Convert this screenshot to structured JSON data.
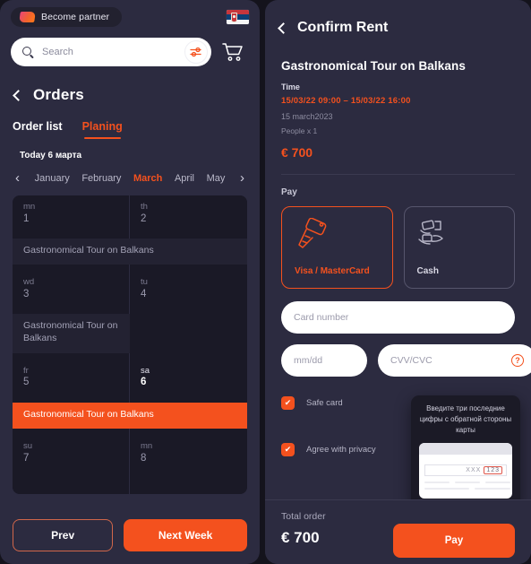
{
  "left": {
    "partner_badge": {
      "label": "Become partner",
      "icon": "partner-logo-icon"
    },
    "flag": "serbia-flag-icon",
    "search": {
      "value": "",
      "placeholder": "Search",
      "icon": "search-icon",
      "filter_icon": "filter-sliders-icon"
    },
    "cart_icon": "shopping-cart-icon",
    "back_icon": "chevron-left-icon",
    "page_title": "Orders",
    "tabs": [
      {
        "label": "Order list",
        "active": false
      },
      {
        "label": "Planing",
        "active": true
      }
    ],
    "today_label": "Today 6 марта",
    "month_prev_icon": "chevron-left-icon",
    "month_next_icon": "chevron-right-icon",
    "months": [
      {
        "label": "January",
        "active": false
      },
      {
        "label": "February",
        "active": false
      },
      {
        "label": "March",
        "active": true
      },
      {
        "label": "April",
        "active": false
      },
      {
        "label": "May",
        "active": false
      }
    ],
    "calendar": {
      "rows": [
        {
          "cells": [
            {
              "dow": "mn",
              "num": "1",
              "today": false
            },
            {
              "dow": "th",
              "num": "2",
              "today": false
            }
          ],
          "event": {
            "text": "Gastronomical Tour on Balkans",
            "span": "full",
            "highlight": false
          }
        },
        {
          "cells": [
            {
              "dow": "wd",
              "num": "3",
              "today": false
            },
            {
              "dow": "tu",
              "num": "4",
              "today": false
            }
          ],
          "event": {
            "text": "Gastronomical Tour on Balkans",
            "span": "half",
            "highlight": false
          }
        },
        {
          "cells": [
            {
              "dow": "fr",
              "num": "5",
              "today": false
            },
            {
              "dow": "sa",
              "num": "6",
              "today": true
            }
          ],
          "event": {
            "text": "Gastronomical Tour on Balkans",
            "span": "full",
            "highlight": true
          }
        },
        {
          "cells": [
            {
              "dow": "su",
              "num": "7",
              "today": false
            },
            {
              "dow": "mn",
              "num": "8",
              "today": false
            }
          ],
          "event": null
        }
      ]
    },
    "buttons": {
      "prev": "Prev",
      "next": "Next Week"
    }
  },
  "right": {
    "back_icon": "chevron-left-icon",
    "title": "Confirm Rent",
    "tour": {
      "name": "Gastronomical Tour on Balkans",
      "time_label": "Time",
      "time_range": "15/03/22 09:00 –  15/03/22 16:00",
      "date": "15 march2023",
      "people": "People x 1",
      "price": "€ 700"
    },
    "pay": {
      "label": "Pay",
      "methods": [
        {
          "label": "Visa / MasterCard",
          "icon": "credit-card-hand-icon",
          "selected": true
        },
        {
          "label": "Cash",
          "icon": "cash-hands-icon",
          "selected": false
        }
      ]
    },
    "form": {
      "card_number": {
        "value": "",
        "placeholder": "Card number"
      },
      "expiry": {
        "value": "",
        "placeholder": "mm/dd"
      },
      "cvv": {
        "value": "",
        "placeholder": "CVV/CVC",
        "help_icon": "question-mark-icon",
        "help_glyph": "?"
      }
    },
    "tooltip": {
      "text": "Введите три последние цифры с обратной стороны карты",
      "card_masked": "XXX",
      "card_cvv": "123"
    },
    "checkboxes": [
      {
        "label": "Safe card",
        "checked": true,
        "glyph": "✔"
      },
      {
        "label": "Agree with privacy",
        "checked": true,
        "glyph": "✔"
      }
    ],
    "footer": {
      "total_label": "Total order",
      "total_value": "€ 700",
      "pay_button": "Pay"
    }
  },
  "colors": {
    "accent": "#f4511e",
    "panel": "#2c2b40",
    "deep": "#1a1926",
    "page": "#14131c"
  }
}
